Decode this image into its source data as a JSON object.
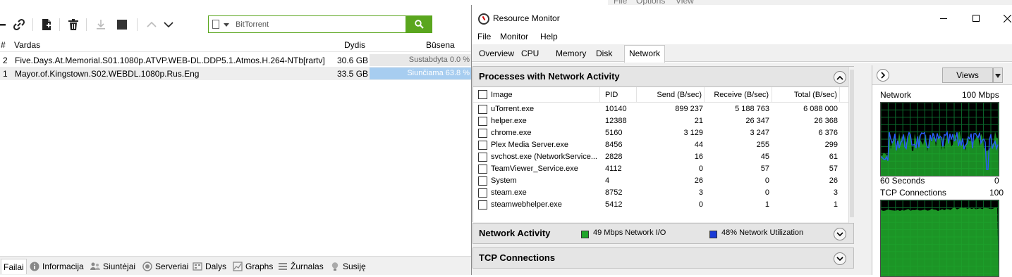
{
  "utorrent": {
    "search": {
      "value": "BitTorrent"
    },
    "columns": {
      "num": "#",
      "name": "Vardas",
      "size": "Dydis",
      "status": "Būsena"
    },
    "torrents": [
      {
        "num": "2",
        "name": "Five.Days.At.Memorial.S01.1080p.ATVP.WEB-DL.DDP5.1.Atmos.H.264-NTb[rartv]",
        "size": "30.6 GB",
        "status": "Sustabdyta 0.0 %"
      },
      {
        "num": "1",
        "name": "Mayor.of.Kingstown.S02.WEBDL.1080p.Rus.Eng",
        "size": "33.5 GB",
        "status": "Siunčiama 63.8 %"
      }
    ],
    "tabs": [
      "Failai",
      "Informacija",
      "Siuntėjai",
      "Serveriai",
      "Dalys",
      "Graphs",
      "Žurnalas",
      "Susiję"
    ],
    "icons": [
      "remove-icon",
      "link-icon",
      "new-torrent-icon",
      "delete-icon",
      "download-icon",
      "stop-icon",
      "up-icon",
      "down-icon",
      "search-icon"
    ]
  },
  "behind_menu": {
    "file": "File",
    "options": "Options",
    "view": "View"
  },
  "resmon": {
    "title": "Resource Monitor",
    "menu": {
      "file": "File",
      "monitor": "Monitor",
      "help": "Help"
    },
    "tabs": [
      "Overview",
      "CPU",
      "Memory",
      "Disk",
      "Network"
    ],
    "processes": {
      "title": "Processes with Network Activity",
      "columns": {
        "image": "Image",
        "pid": "PID",
        "send": "Send (B/sec)",
        "receive": "Receive (B/sec)",
        "total": "Total (B/sec)"
      },
      "rows": [
        {
          "image": "uTorrent.exe",
          "pid": "10140",
          "send": "899 237",
          "receive": "5 188 763",
          "total": "6 088 000"
        },
        {
          "image": "helper.exe",
          "pid": "12388",
          "send": "21",
          "receive": "26 347",
          "total": "26 368"
        },
        {
          "image": "chrome.exe",
          "pid": "5160",
          "send": "3 129",
          "receive": "3 247",
          "total": "6 376"
        },
        {
          "image": "Plex Media Server.exe",
          "pid": "8456",
          "send": "44",
          "receive": "255",
          "total": "299"
        },
        {
          "image": "svchost.exe (NetworkService...",
          "pid": "2828",
          "send": "16",
          "receive": "45",
          "total": "61"
        },
        {
          "image": "TeamViewer_Service.exe",
          "pid": "4112",
          "send": "0",
          "receive": "57",
          "total": "57"
        },
        {
          "image": "System",
          "pid": "4",
          "send": "26",
          "receive": "0",
          "total": "26"
        },
        {
          "image": "steam.exe",
          "pid": "8752",
          "send": "3",
          "receive": "0",
          "total": "3"
        },
        {
          "image": "steamwebhelper.exe",
          "pid": "5412",
          "send": "0",
          "receive": "1",
          "total": "1"
        }
      ]
    },
    "network_activity": {
      "title": "Network Activity",
      "io": "49 Mbps Network I/O",
      "util": "48% Network Utilization",
      "io_color": "#1fa52a",
      "util_color": "#1a3bd6"
    },
    "tcp": {
      "title": "TCP Connections"
    },
    "side": {
      "views": "Views",
      "network_label": "Network",
      "network_max": "100 Mbps",
      "seconds": "60 Seconds",
      "zero": "0",
      "tcp_label": "TCP Connections",
      "tcp_max": "100"
    }
  }
}
